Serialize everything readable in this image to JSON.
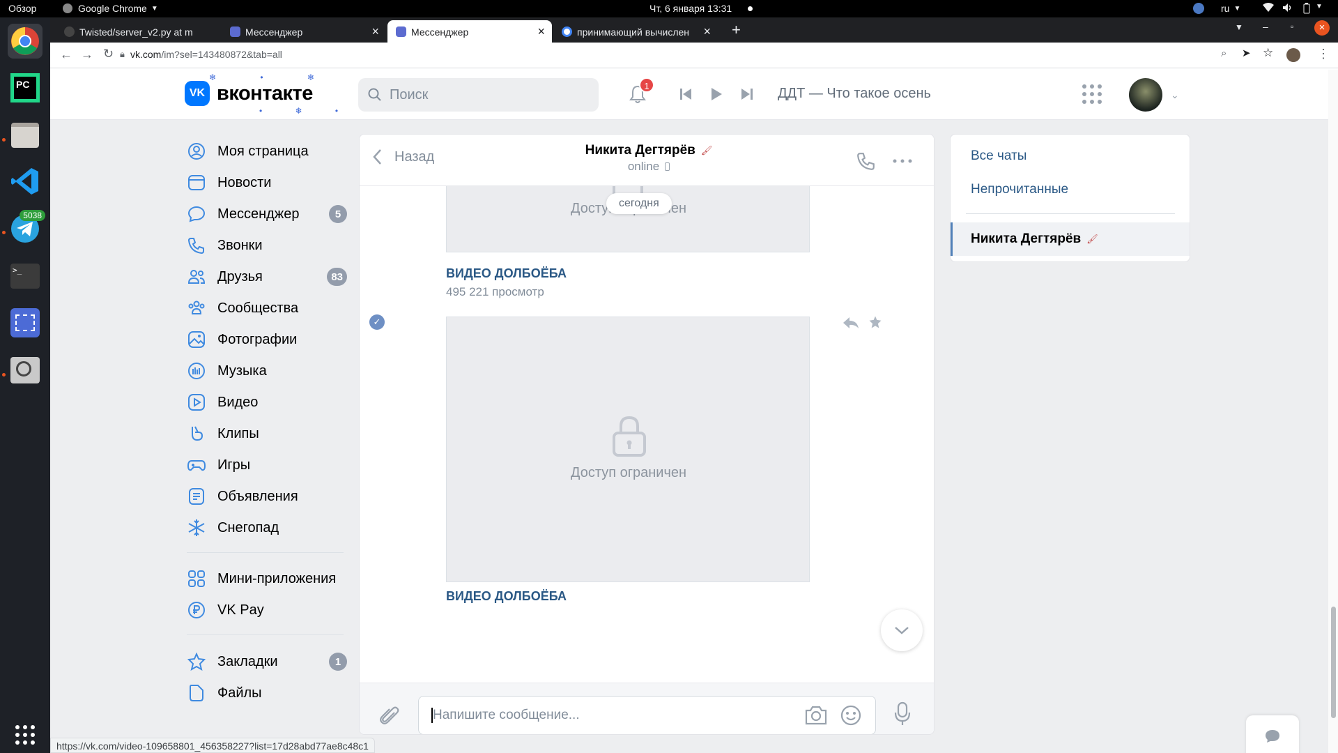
{
  "system_bar": {
    "overview": "Обзор",
    "app_name": "Google Chrome",
    "datetime": "Чт, 6 января  13:31",
    "language": "ru"
  },
  "dock": {
    "telegram_badge": "5038"
  },
  "browser": {
    "tabs": [
      {
        "title": "Twisted/server_v2.py at m"
      },
      {
        "title": "Мессенджер"
      },
      {
        "title": "Мессенджер"
      },
      {
        "title": "принимающий вычислен"
      }
    ],
    "new_tab": "+",
    "url_host": "vk.com",
    "url_path": "/im?sel=143480872&tab=all"
  },
  "vk_header": {
    "logo_text": "вконтакте",
    "search_placeholder": "Поиск",
    "notification_count": "1",
    "now_playing": "ДДТ — Что такое осень"
  },
  "left_menu": {
    "items": [
      {
        "label": "Моя страница",
        "badge": ""
      },
      {
        "label": "Новости",
        "badge": ""
      },
      {
        "label": "Мессенджер",
        "badge": "5"
      },
      {
        "label": "Звонки",
        "badge": ""
      },
      {
        "label": "Друзья",
        "badge": "83"
      },
      {
        "label": "Сообщества",
        "badge": ""
      },
      {
        "label": "Фотографии",
        "badge": ""
      },
      {
        "label": "Музыка",
        "badge": ""
      },
      {
        "label": "Видео",
        "badge": ""
      },
      {
        "label": "Клипы",
        "badge": ""
      },
      {
        "label": "Игры",
        "badge": ""
      },
      {
        "label": "Объявления",
        "badge": ""
      },
      {
        "label": "Снегопад",
        "badge": ""
      }
    ],
    "extra_items": [
      {
        "label": "Мини-приложения",
        "badge": ""
      },
      {
        "label": "VK Pay",
        "badge": ""
      }
    ],
    "bottom_items": [
      {
        "label": "Закладки",
        "badge": "1"
      },
      {
        "label": "Файлы",
        "badge": ""
      }
    ]
  },
  "chat": {
    "back_label": "Назад",
    "contact_name": "Никита Дегтярёв",
    "status": "online",
    "date_divider": "сегодня",
    "messages": [
      {
        "locked_text": "Доступ ограничен",
        "video_title": "ВИДЕО ДОЛБОЁБА",
        "views": "495 221 просмотр"
      },
      {
        "locked_text": "Доступ ограничен",
        "video_title": "ВИДЕО ДОЛБОЁБА",
        "views": ""
      }
    ],
    "input_placeholder": "Напишите сообщение..."
  },
  "right_panel": {
    "all_chats": "Все чаты",
    "unread": "Непрочитанные",
    "active_chat": "Никита Дегтярёв"
  },
  "status_url": "https://vk.com/video-109658801_456358227?list=17d28abd77ae8c48c1",
  "colors": {
    "vk_blue": "#0077ff",
    "link_blue": "#2a5885",
    "badge_gray": "#939cab",
    "notification_red": "#e64646",
    "icon_blue": "#3f8ae0"
  }
}
